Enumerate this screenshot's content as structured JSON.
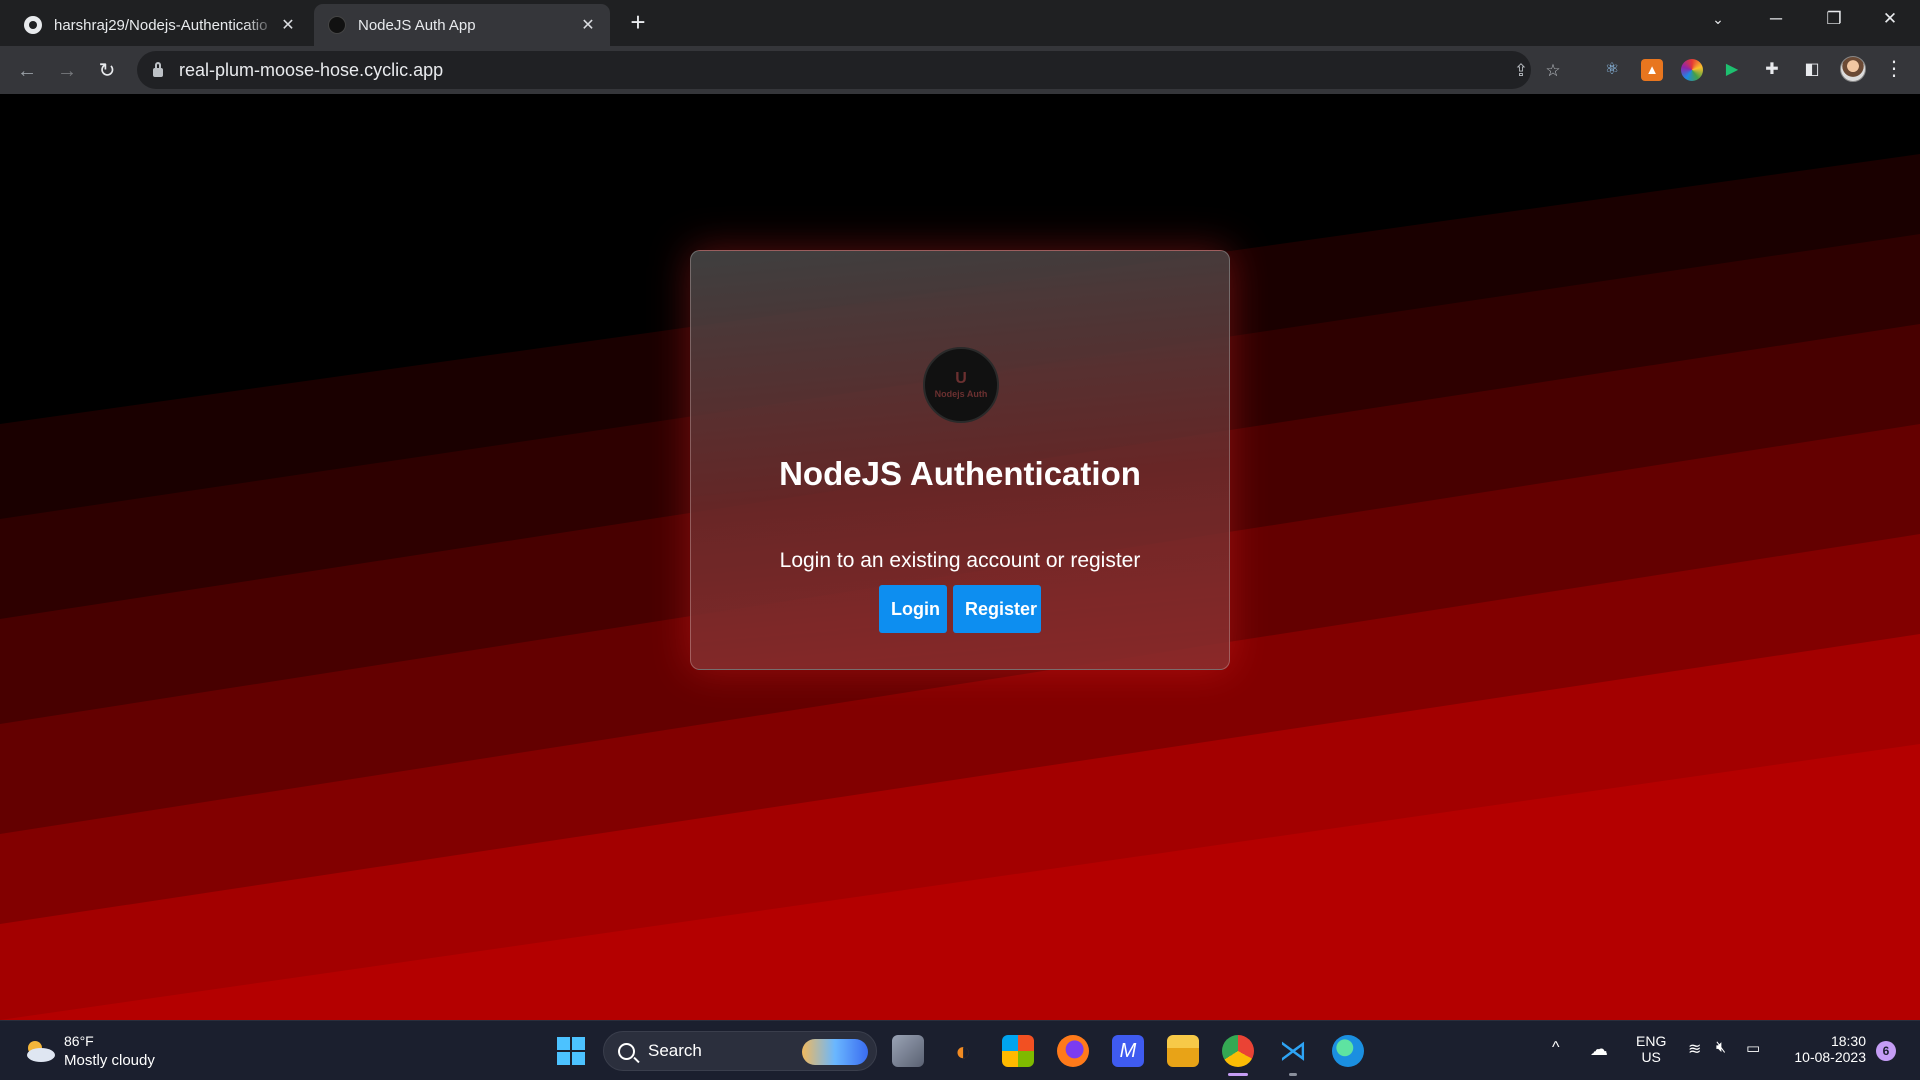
{
  "browser": {
    "tabs": [
      {
        "title": "harshraj29/Nodejs-Authenticatio",
        "active": false
      },
      {
        "title": "NodeJS Auth App",
        "active": true
      }
    ],
    "url": "real-plum-moose-hose.cyclic.app"
  },
  "page": {
    "logo_text": "Nodejs Auth",
    "heading": "NodeJS Authentication",
    "subtitle": "Login to an existing account or register",
    "login_label": "Login",
    "register_label": "Register",
    "button_color": "#0d8ef0"
  },
  "taskbar": {
    "weather_temp": "86°F",
    "weather_desc": "Mostly cloudy",
    "search_label": "Search",
    "lang_top": "ENG",
    "lang_bottom": "US",
    "time": "18:30",
    "date": "10-08-2023",
    "notification_count": "6"
  }
}
